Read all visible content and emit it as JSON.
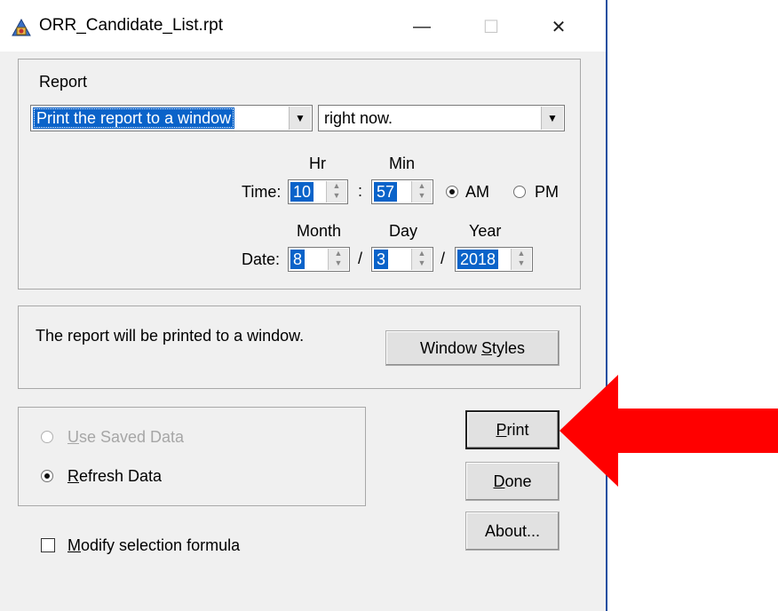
{
  "window": {
    "title": "ORR_Candidate_List.rpt"
  },
  "titlebar": {
    "minimize": "—",
    "maximize": "☐",
    "close": "✕"
  },
  "report": {
    "group_label": "Report",
    "destination": "Print the report to a window",
    "when": "right now.",
    "time": {
      "label": "Time:",
      "hr_label": "Hr",
      "min_label": "Min",
      "hr": "10",
      "separator": ":",
      "min": "57",
      "am": "AM",
      "pm": "PM"
    },
    "date": {
      "label": "Date:",
      "month_label": "Month",
      "day_label": "Day",
      "year_label": "Year",
      "month": "8",
      "day": "3",
      "year": "2018",
      "sep1": "/",
      "sep2": "/"
    }
  },
  "info": {
    "message": "The report will be printed to a window.",
    "window_styles_pre": "Window ",
    "window_styles_u": "S",
    "window_styles_post": "tyles"
  },
  "data_options": {
    "use_saved_u": "U",
    "use_saved_rest": "se Saved Data",
    "refresh_u": "R",
    "refresh_rest": "efresh Data"
  },
  "modify": {
    "u": "M",
    "rest": "odify selection formula"
  },
  "buttons": {
    "print_u": "P",
    "print_rest": "rint",
    "done_u": "D",
    "done_rest": "one",
    "about": "About..."
  },
  "colors": {
    "annotation_arrow": "#ff0000",
    "selection": "#0a63c9"
  }
}
